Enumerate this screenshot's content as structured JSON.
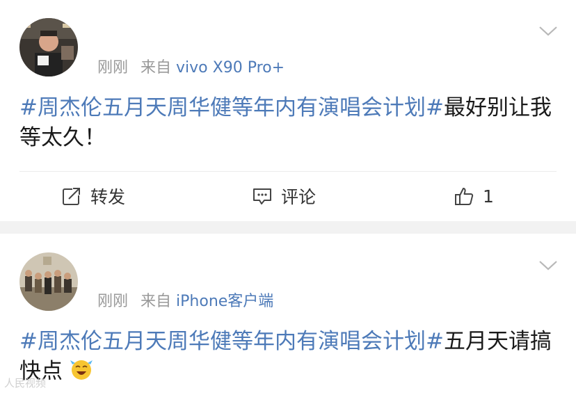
{
  "posts": [
    {
      "time": "刚刚",
      "source_prefix": "来自",
      "source_device": "vivo X90 Pro+",
      "topic": "#周杰伦五月天周华健等年内有演唱会计划#",
      "text": "最好别让我等太久！",
      "has_emoji": false,
      "actions": {
        "repost_label": "转发",
        "comment_label": "评论",
        "like_count": "1"
      }
    },
    {
      "time": "刚刚",
      "source_prefix": "来自",
      "source_device": "iPhone客户端",
      "topic": "#周杰伦五月天周华健等年内有演唱会计划#",
      "text": "五月天请搞快点",
      "has_emoji": true
    }
  ],
  "watermark": "人民视频",
  "colors": {
    "link": "#4d7ab8",
    "meta": "#999999",
    "separator": "#f2f2f2"
  }
}
